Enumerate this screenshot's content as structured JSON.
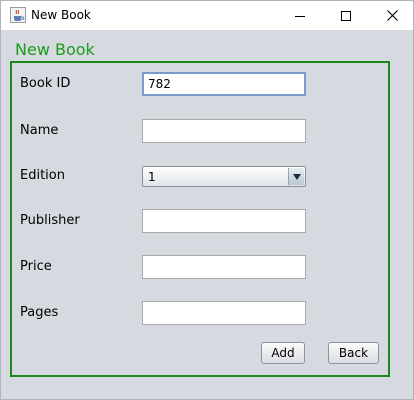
{
  "window": {
    "title": "New Book"
  },
  "panel": {
    "title": "New Book"
  },
  "form": {
    "book_id": {
      "label": "Book ID",
      "value": "782"
    },
    "name": {
      "label": "Name",
      "value": ""
    },
    "edition": {
      "label": "Edition",
      "value": "1"
    },
    "publisher": {
      "label": "Publisher",
      "value": ""
    },
    "price": {
      "label": "Price",
      "value": ""
    },
    "pages": {
      "label": "Pages",
      "value": ""
    }
  },
  "buttons": {
    "add": "Add",
    "back": "Back"
  },
  "icons": {
    "app": "java-coffee-cup-icon",
    "minimize": "minimize-icon",
    "maximize": "maximize-icon",
    "close": "close-icon",
    "dropdown": "chevron-down-icon"
  },
  "colors": {
    "panel_accent": "#1a8a1a",
    "focus_border": "#7a9cc8"
  }
}
